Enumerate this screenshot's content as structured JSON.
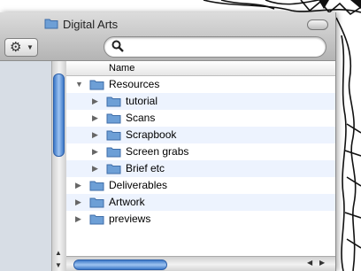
{
  "window": {
    "title": "Digital Arts"
  },
  "toolbar": {
    "search_placeholder": ""
  },
  "list": {
    "column_name": "Name",
    "rows": [
      {
        "label": "Resources",
        "expanded": true,
        "depth": 0
      },
      {
        "label": "tutorial",
        "expanded": false,
        "depth": 1
      },
      {
        "label": "Scans",
        "expanded": false,
        "depth": 1
      },
      {
        "label": "Scrapbook",
        "expanded": false,
        "depth": 1
      },
      {
        "label": "Screen grabs",
        "expanded": false,
        "depth": 1
      },
      {
        "label": "Brief etc",
        "expanded": false,
        "depth": 1
      },
      {
        "label": "Deliverables",
        "expanded": false,
        "depth": 0
      },
      {
        "label": "Artwork",
        "expanded": false,
        "depth": 0
      },
      {
        "label": "previews",
        "expanded": false,
        "depth": 0
      }
    ]
  },
  "colors": {
    "folder": "#6d9fd6",
    "stripe": "#edf3fe",
    "accent": "#3c78c8"
  },
  "icons": {
    "action": "gear-icon",
    "search": "search-icon",
    "folder": "folder-icon"
  }
}
